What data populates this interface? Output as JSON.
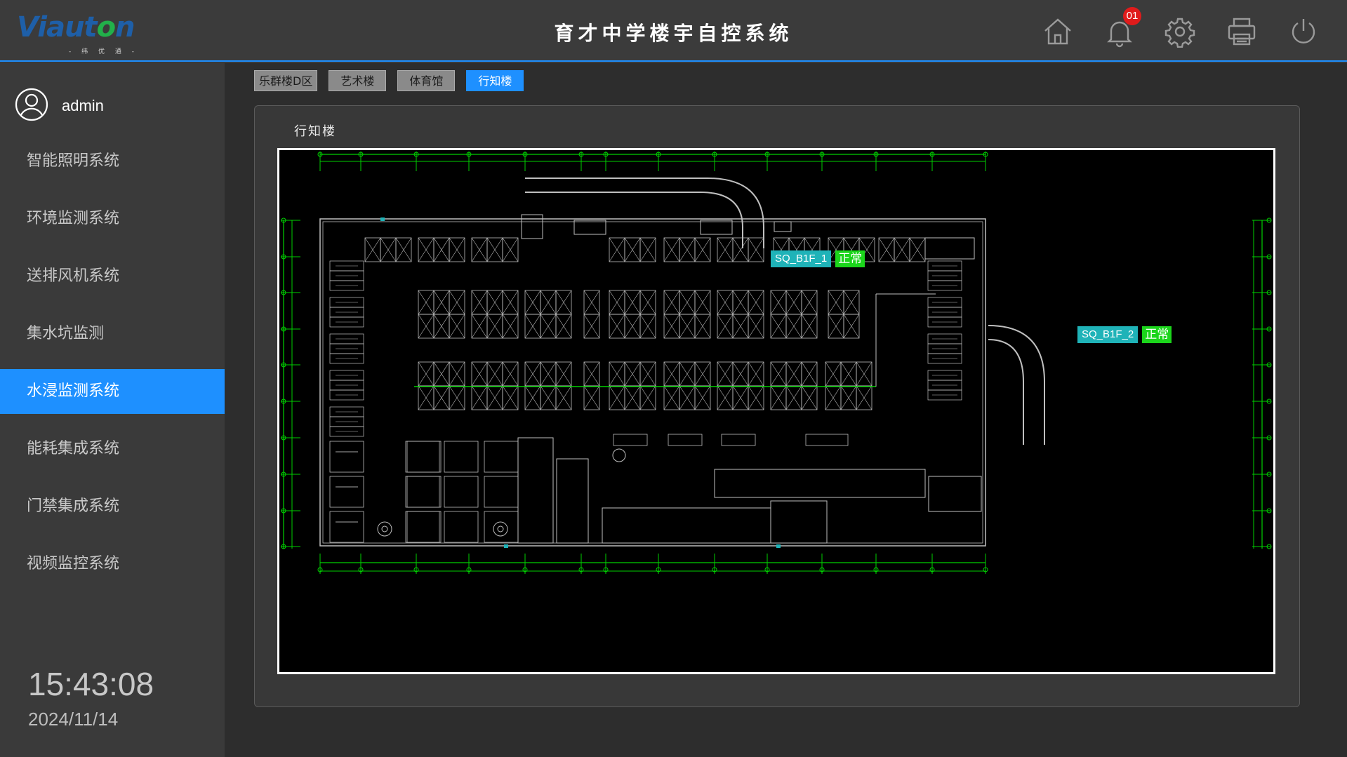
{
  "header": {
    "logo_text_pre": "Viaut",
    "logo_text_o": "o",
    "logo_text_post": "n",
    "logo_sub": "- 纬 优 通 -",
    "title": "育才中学楼宇自控系统",
    "notification_count": "01",
    "icons": [
      "home-icon",
      "bell-icon",
      "gear-icon",
      "printer-icon",
      "power-icon"
    ]
  },
  "user": {
    "name": "admin"
  },
  "menu": [
    {
      "label": "智能照明系统",
      "active": false
    },
    {
      "label": "环境监测系统",
      "active": false
    },
    {
      "label": "送排风机系统",
      "active": false
    },
    {
      "label": "集水坑监测",
      "active": false
    },
    {
      "label": "水浸监测系统",
      "active": true
    },
    {
      "label": "能耗集成系统",
      "active": false
    },
    {
      "label": "门禁集成系统",
      "active": false
    },
    {
      "label": "视频监控系统",
      "active": false
    }
  ],
  "clock": {
    "time": "15:43:08",
    "date": "2024/11/14"
  },
  "tabs": [
    {
      "label": "乐群楼D区",
      "active": false
    },
    {
      "label": "艺术楼",
      "active": false
    },
    {
      "label": "体育馆",
      "active": false
    },
    {
      "label": "行知楼",
      "active": true
    }
  ],
  "panel": {
    "title": "行知楼"
  },
  "sensors": [
    {
      "id": "SQ_B1F_1",
      "status": "正常"
    },
    {
      "id": "SQ_B1F_2",
      "status": "正常"
    }
  ],
  "colors": {
    "accent": "#1e90ff",
    "sensor_id_bg": "#1fb3b8",
    "status_ok": "#1bd51b",
    "badge": "#e01b1b"
  }
}
